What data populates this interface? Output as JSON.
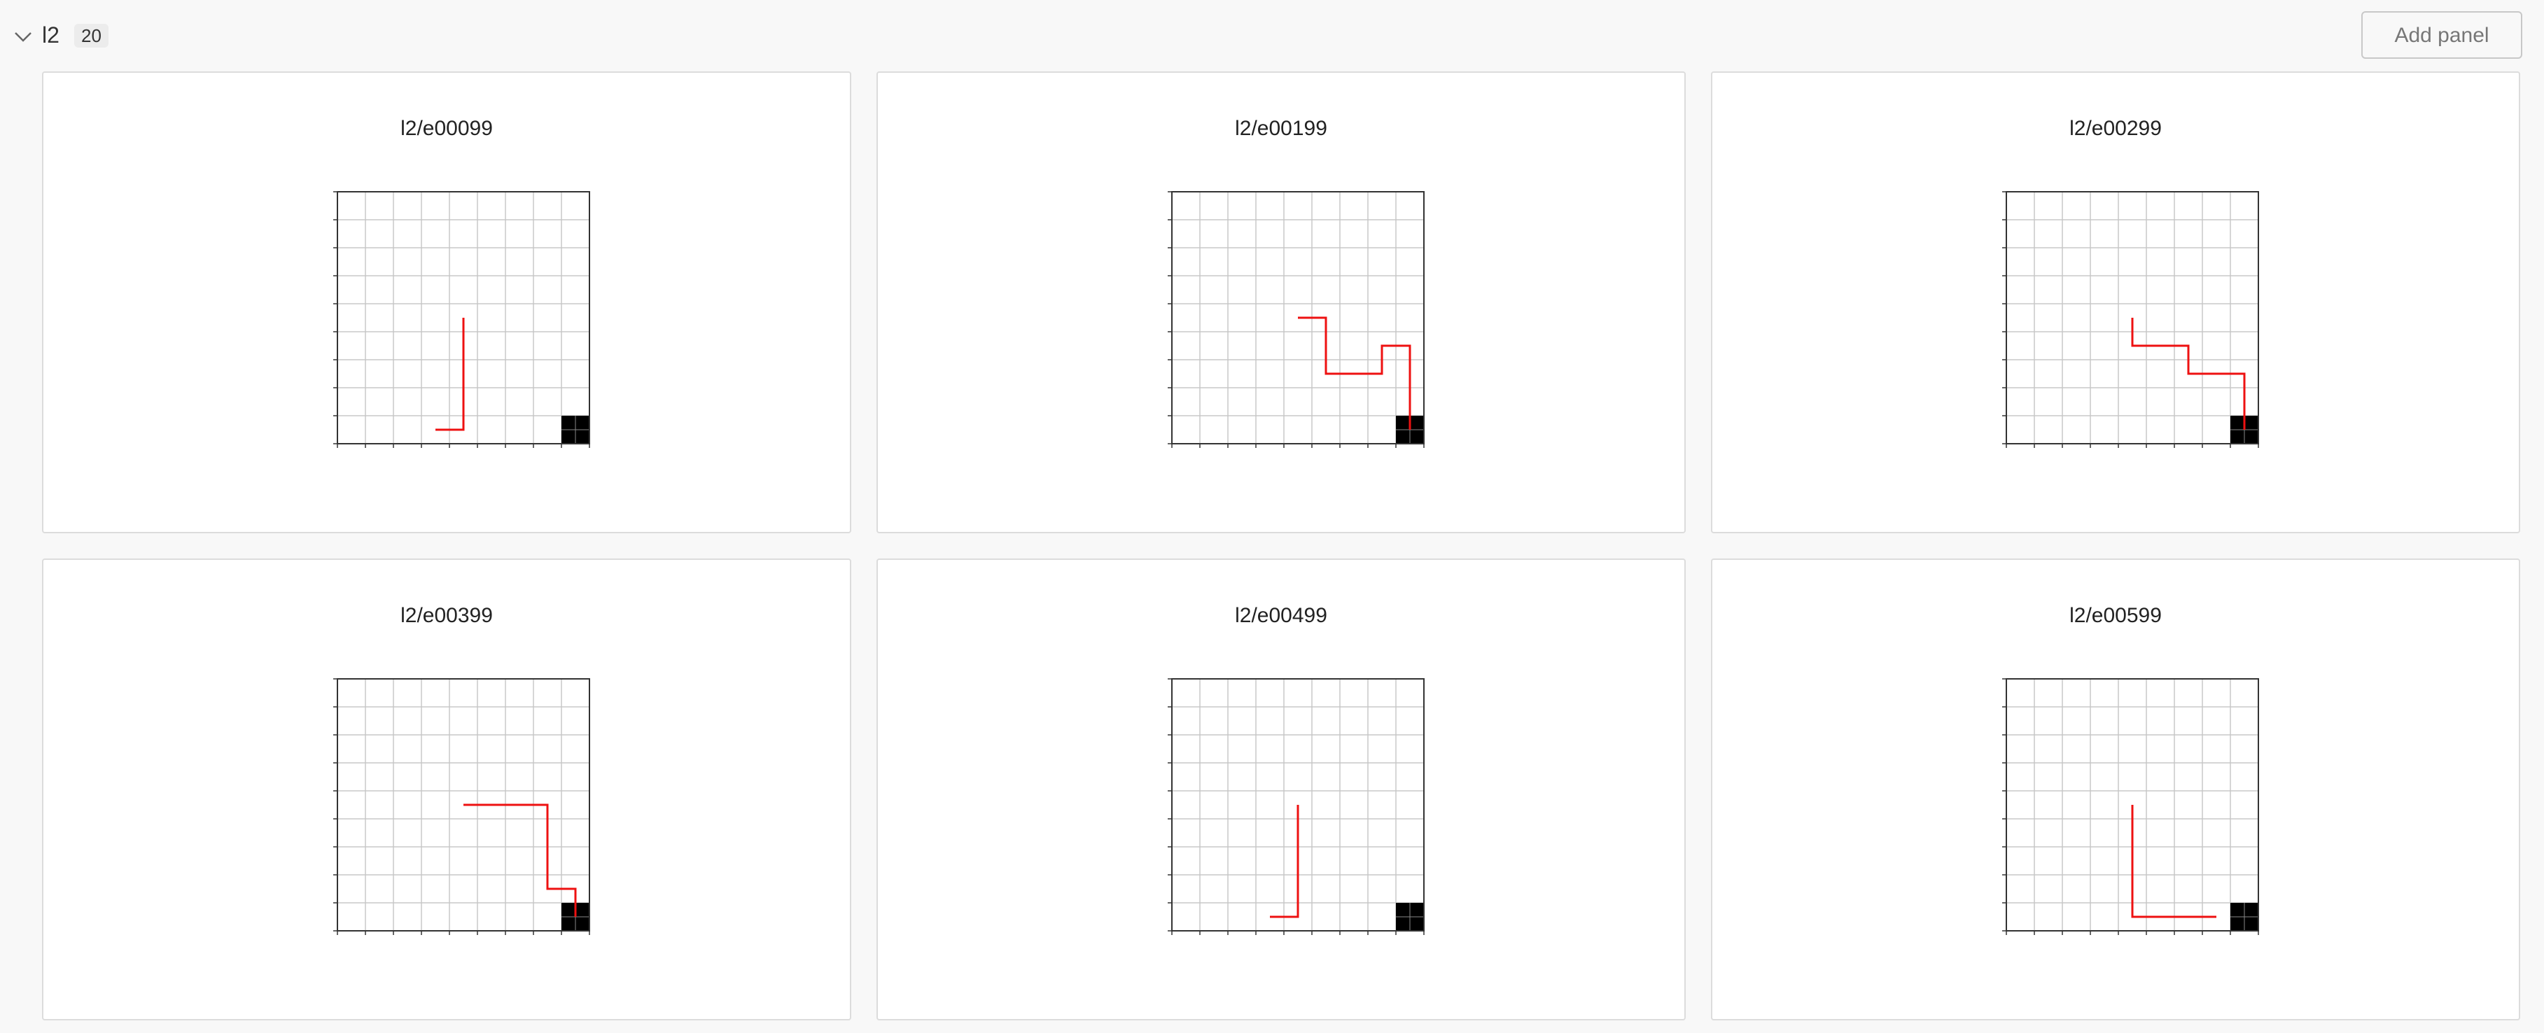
{
  "section": {
    "title": "l2",
    "count": "20",
    "add_panel_label": "Add panel"
  },
  "colors": {
    "path": "#ee1111",
    "goal": "#000000",
    "grid": "#c8c8c8",
    "frame": "#333333"
  },
  "icons": {
    "collapse": "chevron-down-icon"
  },
  "panels": [
    {
      "title": "l2/e00099",
      "chart_data": {
        "type": "line",
        "grid_size": 9,
        "path": [
          [
            3.5,
            0.5
          ],
          [
            4.5,
            0.5
          ],
          [
            4.5,
            4.5
          ]
        ],
        "goal_cell": [
          8,
          0
        ]
      }
    },
    {
      "title": "l2/e00199",
      "chart_data": {
        "type": "line",
        "grid_size": 9,
        "path": [
          [
            4.5,
            4.5
          ],
          [
            5.5,
            4.5
          ],
          [
            5.5,
            2.5
          ],
          [
            7.5,
            2.5
          ],
          [
            7.5,
            3.5
          ],
          [
            8.5,
            3.5
          ],
          [
            8.5,
            0.5
          ]
        ],
        "goal_cell": [
          8,
          0
        ]
      }
    },
    {
      "title": "l2/e00299",
      "chart_data": {
        "type": "line",
        "grid_size": 9,
        "path": [
          [
            4.5,
            4.5
          ],
          [
            4.5,
            3.5
          ],
          [
            6.5,
            3.5
          ],
          [
            6.5,
            2.5
          ],
          [
            8.5,
            2.5
          ],
          [
            8.5,
            0.5
          ]
        ],
        "goal_cell": [
          8,
          0
        ]
      }
    },
    {
      "title": "l2/e00399",
      "chart_data": {
        "type": "line",
        "grid_size": 9,
        "path": [
          [
            4.5,
            4.5
          ],
          [
            7.5,
            4.5
          ],
          [
            7.5,
            1.5
          ],
          [
            8.5,
            1.5
          ],
          [
            8.5,
            0.5
          ]
        ],
        "goal_cell": [
          8,
          0
        ]
      }
    },
    {
      "title": "l2/e00499",
      "chart_data": {
        "type": "line",
        "grid_size": 9,
        "path": [
          [
            4.5,
            4.5
          ],
          [
            4.5,
            0.5
          ],
          [
            3.5,
            0.5
          ]
        ],
        "goal_cell": [
          8,
          0
        ]
      }
    },
    {
      "title": "l2/e00599",
      "chart_data": {
        "type": "line",
        "grid_size": 9,
        "path": [
          [
            4.5,
            4.5
          ],
          [
            4.5,
            0.5
          ],
          [
            7.5,
            0.5
          ]
        ],
        "goal_cell": [
          8,
          0
        ]
      }
    }
  ]
}
